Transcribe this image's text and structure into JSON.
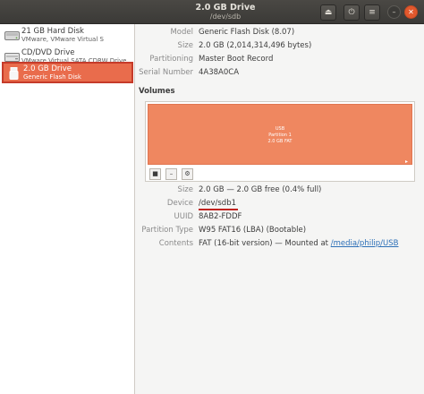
{
  "window": {
    "title": "2.0 GB Drive",
    "subtitle": "/dev/sdb",
    "buttons": {
      "eject": "⏏",
      "power": "⏻",
      "menu": "≡",
      "minimize": "–",
      "close": "✕"
    }
  },
  "sidebar": {
    "drives": [
      {
        "name": "21 GB Hard Disk",
        "sub": "VMware, VMware Virtual S",
        "icon": "hard-disk-icon",
        "selected": false
      },
      {
        "name": "CD/DVD Drive",
        "sub": "VMware Virtual SATA CDRW Drive",
        "icon": "optical-drive-icon",
        "selected": false
      },
      {
        "name": "2.0 GB Drive",
        "sub": "Generic Flash Disk",
        "icon": "usb-drive-icon",
        "selected": true
      }
    ]
  },
  "details": [
    {
      "label": "Model",
      "value": "Generic Flash Disk (8.07)"
    },
    {
      "label": "Size",
      "value": "2.0 GB (2,014,314,496 bytes)"
    },
    {
      "label": "Partitioning",
      "value": "Master Boot Record"
    },
    {
      "label": "Serial Number",
      "value": "4A38A0CA"
    }
  ],
  "volumes": {
    "heading": "Volumes",
    "partition": {
      "name": "USB",
      "line2": "Partition 1",
      "line3": "2.0 GB FAT"
    },
    "toolbar": {
      "stop": "■",
      "minus": "–",
      "settings": "⚙"
    }
  },
  "volume_details": {
    "size_label": "Size",
    "size_value": "2.0 GB — 2.0 GB free (0.4% full)",
    "device_label": "Device",
    "device_value": "/dev/sdb1",
    "uuid_label": "UUID",
    "uuid_value": "8AB2-FDDF",
    "ptype_label": "Partition Type",
    "ptype_value": "W95 FAT16 (LBA) (Bootable)",
    "contents_label": "Contents",
    "contents_prefix": "FAT (16-bit version) — Mounted at ",
    "contents_link": "/media/philip/USB"
  },
  "colors": {
    "selection": "#e96c4c",
    "partition": "#ef8760",
    "titlebar": "#3b3a37",
    "close": "#e2582d",
    "link": "#2c6fb7",
    "underline": "#c0231f"
  }
}
